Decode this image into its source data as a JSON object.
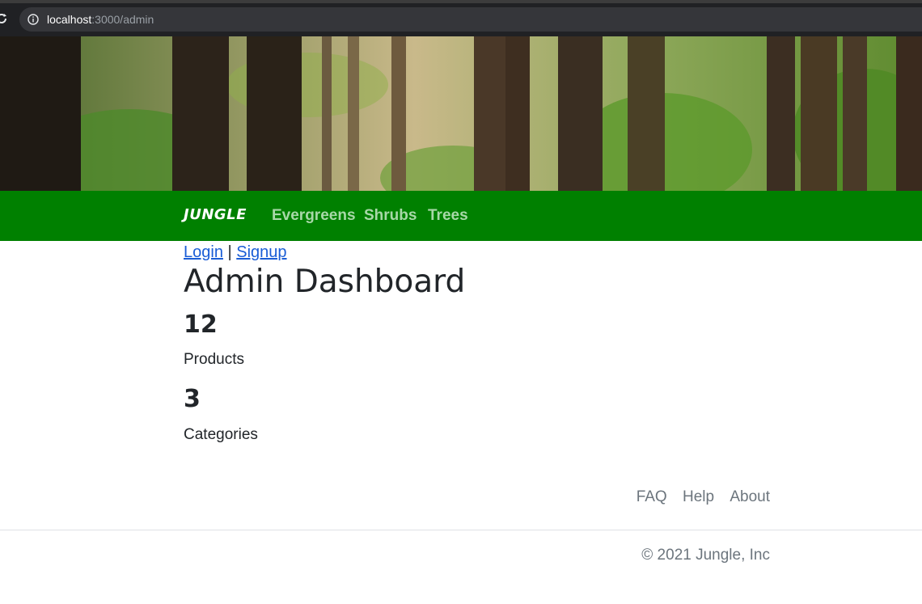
{
  "browser": {
    "url_host": "localhost",
    "url_rest": ":3000/admin"
  },
  "nav": {
    "brand": "JUNGLE",
    "links": [
      "Evergreens",
      "Shrubs",
      "Trees"
    ]
  },
  "auth": {
    "login": "Login",
    "separator": "|",
    "signup": "Signup"
  },
  "main": {
    "title": "Admin Dashboard",
    "stats": [
      {
        "value": "12",
        "label": "Products"
      },
      {
        "value": "3",
        "label": "Categories"
      }
    ]
  },
  "footer": {
    "links": [
      "FAQ",
      "Help",
      "About"
    ],
    "copyright": "© 2021 Jungle, Inc"
  },
  "colors": {
    "navbar": "#008000",
    "nav_link": "#a8d8a8",
    "link": "#1a5dd6",
    "muted": "#6c757d"
  },
  "icons": {
    "reload": "reload-icon",
    "info": "info-icon"
  }
}
